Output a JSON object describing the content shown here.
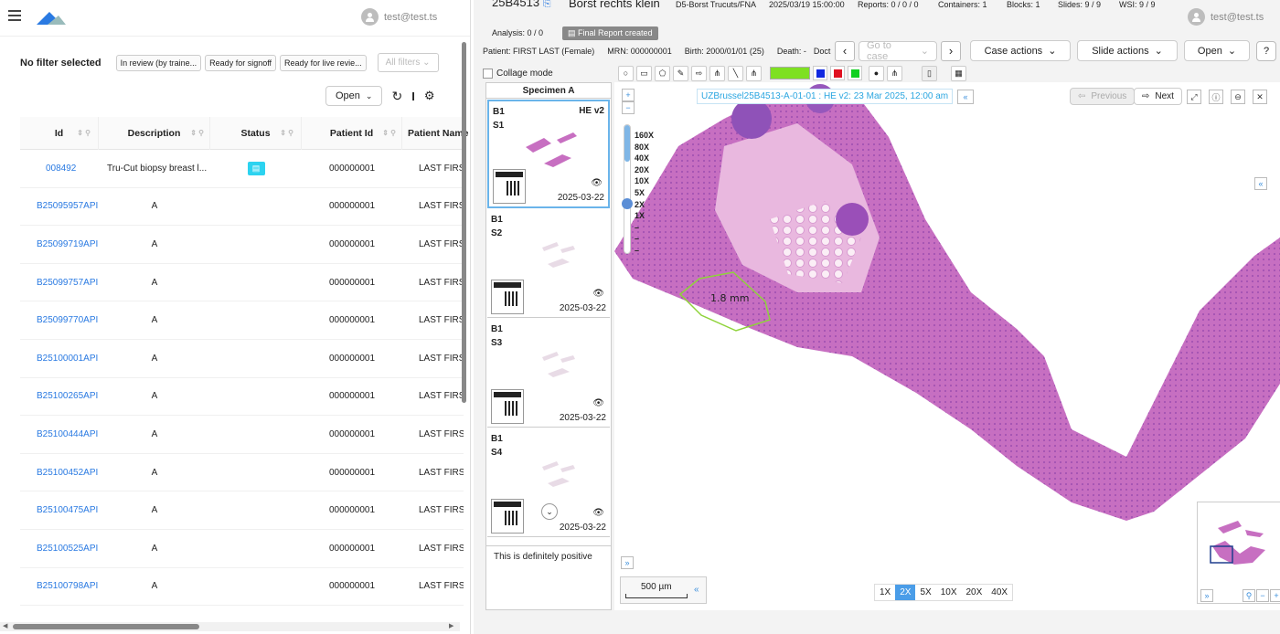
{
  "left": {
    "user": "test@test.ts",
    "no_filter": "No filter selected",
    "chips": [
      "In review (by traine...",
      "Ready for signoff",
      "Ready for live revie..."
    ],
    "all_filters": "All filters",
    "open_btn": "Open",
    "columns": [
      "Id",
      "Description",
      "Status",
      "Patient Id",
      "Patient Name"
    ],
    "rows": [
      {
        "id": "008492",
        "desc": "Tru-Cut biopsy breast l...",
        "status": "badge",
        "pid": "000000001",
        "pname": "LAST FIRST"
      },
      {
        "id": "B25095957API",
        "desc": "A",
        "status": "",
        "pid": "000000001",
        "pname": "LAST FIRST"
      },
      {
        "id": "B25099719API",
        "desc": "A",
        "status": "",
        "pid": "000000001",
        "pname": "LAST FIRST"
      },
      {
        "id": "B25099757API",
        "desc": "A",
        "status": "",
        "pid": "000000001",
        "pname": "LAST FIRST"
      },
      {
        "id": "B25099770API",
        "desc": "A",
        "status": "",
        "pid": "000000001",
        "pname": "LAST FIRST"
      },
      {
        "id": "B25100001API",
        "desc": "A",
        "status": "",
        "pid": "000000001",
        "pname": "LAST FIRST"
      },
      {
        "id": "B25100265API",
        "desc": "A",
        "status": "",
        "pid": "000000001",
        "pname": "LAST FIRST"
      },
      {
        "id": "B25100444API",
        "desc": "A",
        "status": "",
        "pid": "000000001",
        "pname": "LAST FIRST"
      },
      {
        "id": "B25100452API",
        "desc": "A",
        "status": "",
        "pid": "000000001",
        "pname": "LAST FIRST"
      },
      {
        "id": "B25100475API",
        "desc": "A",
        "status": "",
        "pid": "000000001",
        "pname": "LAST FIRST"
      },
      {
        "id": "B25100525API",
        "desc": "A",
        "status": "",
        "pid": "000000001",
        "pname": "LAST FIRST"
      },
      {
        "id": "B25100798API",
        "desc": "A",
        "status": "",
        "pid": "000000001",
        "pname": "LAST FIRST"
      }
    ]
  },
  "right": {
    "case_id": "25B4513",
    "case_title": "Borst rechts klein",
    "procedure": "D5-Borst Trucuts/FNA",
    "datetime": "2025/03/19 15:00:00",
    "reports": "Reports: 0 / 0 / 0",
    "containers": "Containers: 1",
    "blocks": "Blocks: 1",
    "slides": "Slides: 9 / 9",
    "wsi": "WSI: 9 / 9",
    "user": "test@test.ts",
    "analysis": "Analysis: 0 / 0",
    "final_report": "Final Report created",
    "patient": "Patient: FIRST LAST (Female)",
    "mrn": "MRN: 000000001",
    "birth": "Birth: 2000/01/01 (25)",
    "death": "Death: -",
    "doctor": "Doct",
    "goto_case": "Go to case",
    "case_actions": "Case actions",
    "slide_actions": "Slide actions",
    "open": "Open",
    "collage": "Collage mode",
    "specimen": "Specimen A",
    "thumbs": [
      {
        "block": "B1",
        "slide": "S1",
        "stain": "HE v2",
        "date": "2025-03-22"
      },
      {
        "block": "B1",
        "slide": "S2",
        "stain": "",
        "date": "2025-03-22"
      },
      {
        "block": "B1",
        "slide": "S3",
        "stain": "",
        "date": "2025-03-22"
      },
      {
        "block": "B1",
        "slide": "S4",
        "stain": "",
        "date": "2025-03-22"
      }
    ],
    "comment": "This is definitely positive",
    "slide_label": "UZBrussel25B4513-A-01-01 : HE v2: 23 Mar 2025, 12:00 am",
    "previous": "Previous",
    "next": "Next",
    "magnifications": [
      "160X",
      "80X",
      "40X",
      "20X",
      "10X",
      "5X",
      "2X",
      "1X"
    ],
    "annotation": "1.8 mm",
    "scale": "500 µm",
    "zoom_buttons": [
      "1X",
      "2X",
      "5X",
      "10X",
      "20X",
      "40X"
    ],
    "zoom_selected": "2X",
    "colors": {
      "green": "#7ee021",
      "blue": "#1028e0",
      "red": "#e01020",
      "lime": "#10d020",
      "accent": "#2a7ae2"
    }
  }
}
